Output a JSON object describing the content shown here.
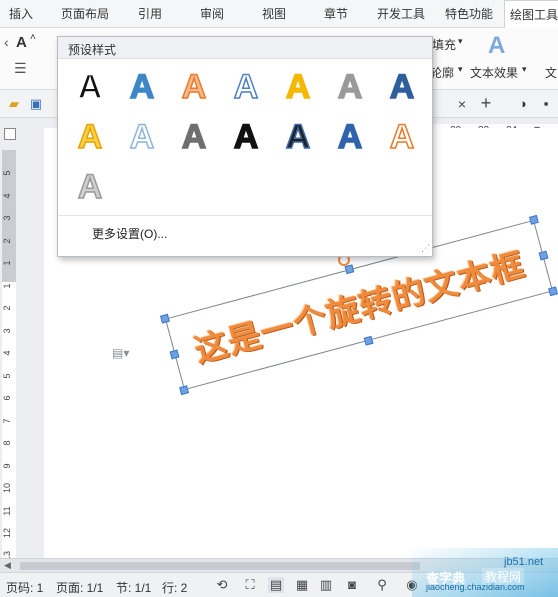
{
  "ribbon_tabs": [
    "插入",
    "页面布局",
    "引用",
    "审阅",
    "视图",
    "章节",
    "开发工具",
    "特色功能",
    "绘图工具"
  ],
  "ribbon": {
    "fill_label": "填充",
    "outline_label": "轮廓",
    "text_effect_label": "文本效果",
    "wordart_icon": "A",
    "text_a_label": "A",
    "right_cut_label": "文"
  },
  "ruler": {
    "h_numbers": [
      "20",
      "22",
      "24"
    ],
    "v_numbers": [
      "5",
      "4",
      "3",
      "2",
      "1",
      "1",
      "2",
      "3",
      "4",
      "5",
      "6",
      "7",
      "8",
      "9",
      "10",
      "11",
      "12",
      "13"
    ]
  },
  "document": {
    "textbox_text": "这是一个旋转的文本框"
  },
  "preset_panel": {
    "title": "预设样式",
    "glyph": "A",
    "more_settings": "更多设置(O)...",
    "style_colors": [
      {
        "fill": "#111111",
        "stroke": "#ffffff"
      },
      {
        "fill": "#3d86c8",
        "stroke": "#3d86c8"
      },
      {
        "fill": "#f7b98c",
        "stroke": "#e87a2b"
      },
      {
        "fill": "#ffffff",
        "stroke": "#4f81bd"
      },
      {
        "fill": "#f5b800",
        "stroke": "#f5b800"
      },
      {
        "fill": "#9a9a9a",
        "stroke": "#9a9a9a"
      },
      {
        "fill": "#2f5e9e",
        "stroke": "#2f5e9e"
      },
      {
        "fill": "#f7d147",
        "stroke": "#e8a200"
      },
      {
        "fill": "#ffffff",
        "stroke": "#8fb5d9"
      },
      {
        "fill": "#6e6e6e",
        "stroke": "#6e6e6e"
      },
      {
        "fill": "#111111",
        "stroke": "#111111"
      },
      {
        "fill": "#222222",
        "stroke": "#3a6bb0"
      },
      {
        "fill": "#2f63ad",
        "stroke": "#2f63ad"
      },
      {
        "fill": "#ffffff",
        "stroke": "#e87a2b"
      },
      {
        "fill": "#cfcfcf",
        "stroke": "#9a9a9a"
      }
    ]
  },
  "status_bar": {
    "page_code": "页码: 1",
    "page": "页面: 1/1",
    "section": "节: 1/1",
    "line": "行: 2"
  },
  "watermark": {
    "site": "jb51.net",
    "brand": "查字典",
    "sub": "教程网",
    "url": "jiaocheng.chazidian.com"
  }
}
